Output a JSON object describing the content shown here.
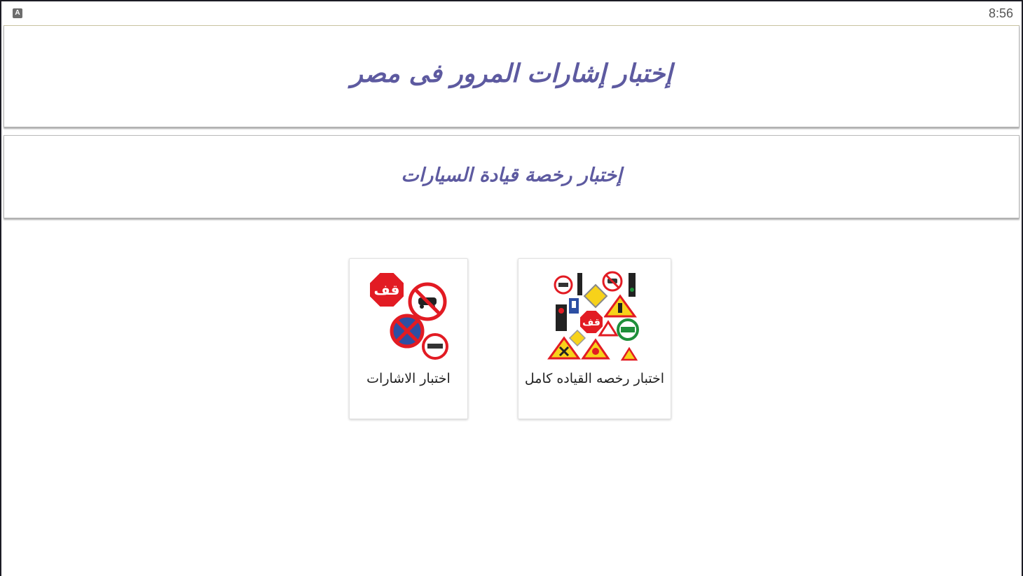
{
  "status_bar": {
    "time": "8:56",
    "app_icon_letter": "A"
  },
  "header": {
    "title": "إختبار إشارات المرور فى مصر"
  },
  "subheader": {
    "title": "إختبار رخصة قيادة السيارات"
  },
  "cards": [
    {
      "label": "اختبار رخصه القياده كامل",
      "icon": "traffic-signs-collage-icon"
    },
    {
      "label": "اختبار الاشارات",
      "icon": "stop-and-prohibition-signs-icon"
    }
  ],
  "sign_text": {
    "stop": "قف"
  },
  "colors": {
    "title": "#5d5aa0",
    "sign_red": "#e21b23",
    "sign_blue": "#2d4fa3",
    "sign_yellow": "#f7d21a",
    "sign_green": "#1e8f3a"
  }
}
